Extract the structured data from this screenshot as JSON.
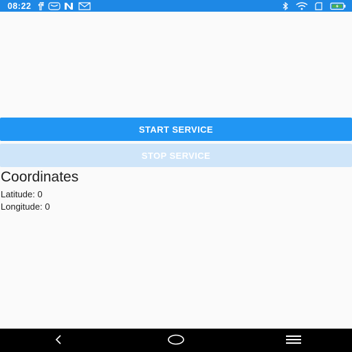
{
  "status_bar": {
    "time": "08:22",
    "background_color": "#1e88e5",
    "left_icons": [
      "facebook-icon",
      "messenger-bot-icon",
      "n-app-icon",
      "mail-icon"
    ],
    "right_icons": [
      "bluetooth-icon",
      "wifi-icon",
      "sim-card-icon",
      "battery-charging-icon"
    ]
  },
  "main": {
    "start_button_label": "START SERVICE",
    "stop_button_label": "STOP SERVICE",
    "coordinates_title": "Coordinates",
    "latitude_text": "Latitude: 0",
    "longitude_text": "Longitude: 0",
    "accent_color": "#2196f3",
    "disabled_color": "#cfe5f9"
  },
  "nav_bar": {
    "buttons": [
      "back-icon",
      "home-icon",
      "menu-icon"
    ]
  }
}
